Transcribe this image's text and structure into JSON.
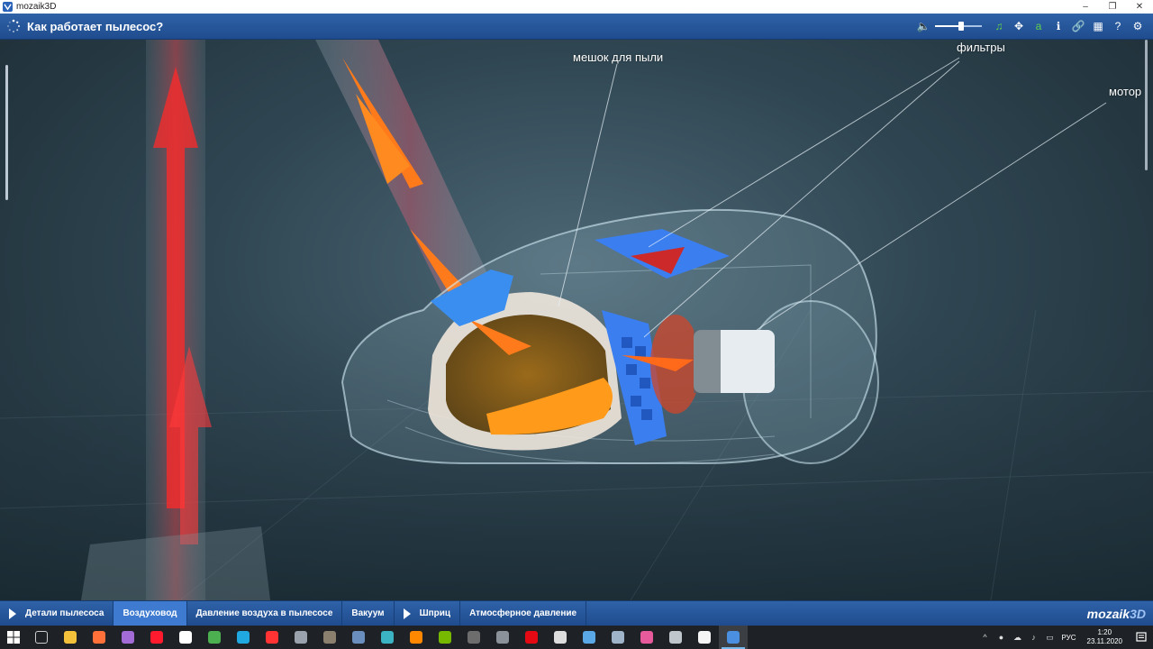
{
  "window": {
    "title": "mozaik3D",
    "controls": [
      "–",
      "❐",
      "✕"
    ]
  },
  "header": {
    "lesson_title": "Как работает пылесос?",
    "toolbar": [
      {
        "name": "volume-icon",
        "glyph": "🔈",
        "color": "#5fd04a"
      },
      {
        "name": "music-icon",
        "glyph": "♫",
        "color": "#5fd04a"
      },
      {
        "name": "move-icon",
        "glyph": "✥",
        "color": "#ffffff"
      },
      {
        "name": "font-icon",
        "glyph": "a",
        "color": "#5fd04a"
      },
      {
        "name": "info-icon",
        "glyph": "ℹ",
        "color": "#ffffff"
      },
      {
        "name": "link-icon",
        "glyph": "🔗",
        "color": "#ffffff"
      },
      {
        "name": "grid-icon",
        "glyph": "▦",
        "color": "#ffffff"
      },
      {
        "name": "help-icon",
        "glyph": "?",
        "color": "#ffffff"
      },
      {
        "name": "gear-icon",
        "glyph": "⚙",
        "color": "#ffffff"
      }
    ],
    "volume_level": 0.55
  },
  "scene": {
    "labels": {
      "bag": "мешок для пыли",
      "filters": "фильтры",
      "motor": "мотор"
    }
  },
  "nav": {
    "items": [
      {
        "label": "Детали пылесоса",
        "play": true,
        "active": false
      },
      {
        "label": "Воздуховод",
        "play": false,
        "active": true
      },
      {
        "label": "Давление воздуха в пылесосе",
        "play": false,
        "active": false
      },
      {
        "label": "Вакуум",
        "play": false,
        "active": false
      },
      {
        "label": "Шприц",
        "play": true,
        "active": false
      },
      {
        "label": "Атмосферное давление",
        "play": false,
        "active": false
      }
    ],
    "brand": "mozaik",
    "brand_suffix": "3D"
  },
  "taskbar": {
    "apps": [
      {
        "name": "task-view-icon",
        "color": "#cccccc"
      },
      {
        "name": "file-explorer-icon",
        "color": "#f3c13a"
      },
      {
        "name": "firefox-icon",
        "color": "#ff7139"
      },
      {
        "name": "app-purple-icon",
        "color": "#a36bd6"
      },
      {
        "name": "opera-icon",
        "color": "#ff1b2d"
      },
      {
        "name": "yandex-browser-icon",
        "color": "#ffffff"
      },
      {
        "name": "chrome-icon",
        "color": "#4caf50"
      },
      {
        "name": "edge-icon",
        "color": "#1fa9e0"
      },
      {
        "name": "yandex-icon",
        "color": "#ff3333"
      },
      {
        "name": "app-gray-icon",
        "color": "#9aa3ad"
      },
      {
        "name": "app-box-icon",
        "color": "#8b7f6e"
      },
      {
        "name": "app-doc-icon",
        "color": "#6a8fbf"
      },
      {
        "name": "app-teal-icon",
        "color": "#3bb3c3"
      },
      {
        "name": "vlc-icon",
        "color": "#ff8800"
      },
      {
        "name": "nvidia-icon",
        "color": "#76b900"
      },
      {
        "name": "calculator-icon",
        "color": "#6d6d6d"
      },
      {
        "name": "camera-icon",
        "color": "#8b9299"
      },
      {
        "name": "netflix-icon",
        "color": "#e50914"
      },
      {
        "name": "gmail-icon",
        "color": "#dddddd"
      },
      {
        "name": "app-blue-icon",
        "color": "#5aa9e6"
      },
      {
        "name": "steam-icon",
        "color": "#9fb4c9"
      },
      {
        "name": "app-drop-icon",
        "color": "#e75a9b"
      },
      {
        "name": "app-window-icon",
        "color": "#bfc6cc"
      },
      {
        "name": "store-icon",
        "color": "#f5f5f5"
      },
      {
        "name": "mozaik-icon",
        "color": "#4a8fe0"
      }
    ],
    "language": "РУС",
    "time": "1:20",
    "date": "23.11.2020"
  }
}
